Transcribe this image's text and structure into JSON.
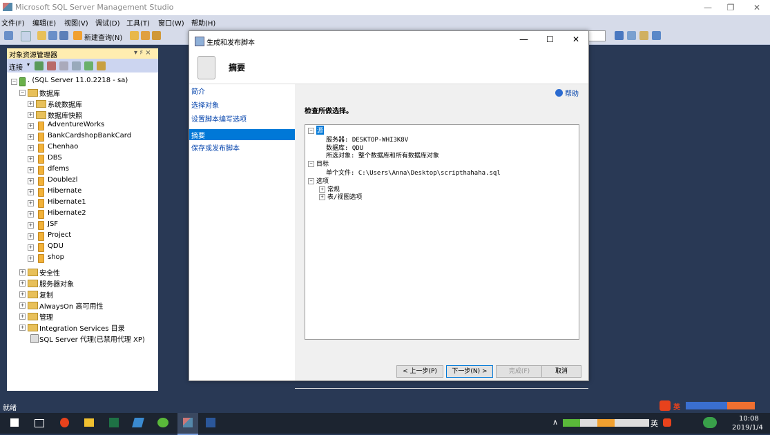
{
  "window": {
    "title": "Microsoft SQL Server Management Studio"
  },
  "menu": [
    "文件(F)",
    "编辑(E)",
    "视图(V)",
    "调试(D)",
    "工具(T)",
    "窗口(W)",
    "帮助(H)"
  ],
  "toolbar": {
    "new_query": "新建查询(N)"
  },
  "object_explorer": {
    "title": "对象资源管理器",
    "pin": "▾ ♯ ×",
    "connect": "连接",
    "server": ". (SQL Server 11.0.2218 - sa)",
    "databases_label": "数据库",
    "items": [
      "系统数据库",
      "数据库快照",
      "AdventureWorks",
      "BankCardshopBankCard",
      "Chenhao",
      "DBS",
      "dfems",
      "Doublezl",
      "Hibernate",
      "Hibernate1",
      "Hibernate2",
      "JSF",
      "Project",
      "QDU",
      "shop"
    ],
    "root_items": [
      "安全性",
      "服务器对象",
      "复制",
      "AlwaysOn 高可用性",
      "管理",
      "Integration Services 目录"
    ],
    "agent": "SQL Server 代理(已禁用代理 XP)"
  },
  "status": {
    "text": "就绪"
  },
  "taskbar": {
    "time": "10:08",
    "date": "2019/1/4",
    "ime": "英",
    "tray_ime": "英"
  },
  "dialog": {
    "title": "生成和发布脚本",
    "header": "摘要",
    "nav": [
      "简介",
      "选择对象",
      "设置脚本编写选项",
      "摘要",
      "保存或发布脚本"
    ],
    "nav_selected": 3,
    "help": "帮助",
    "heading": "检查所做选择。",
    "tree": {
      "source": "源",
      "server": "服务器: DESKTOP-WHI3K8V",
      "database": "数据库: QDU",
      "selected": "所选对象: 整个数据库和所有数据库对象",
      "target": "目标",
      "file": "单个文件: C:\\Users\\Anna\\Desktop\\scripthahaha.sql",
      "options": "选项",
      "general": "常规",
      "table_view": "表/视图选项"
    },
    "buttons": {
      "prev": "< 上一步(P)",
      "next": "下一步(N) >",
      "finish": "完成(F)",
      "cancel": "取消"
    }
  },
  "colors": {
    "accent": "#0078d7",
    "background": "#293955",
    "selected_nav": "#0078d7"
  }
}
